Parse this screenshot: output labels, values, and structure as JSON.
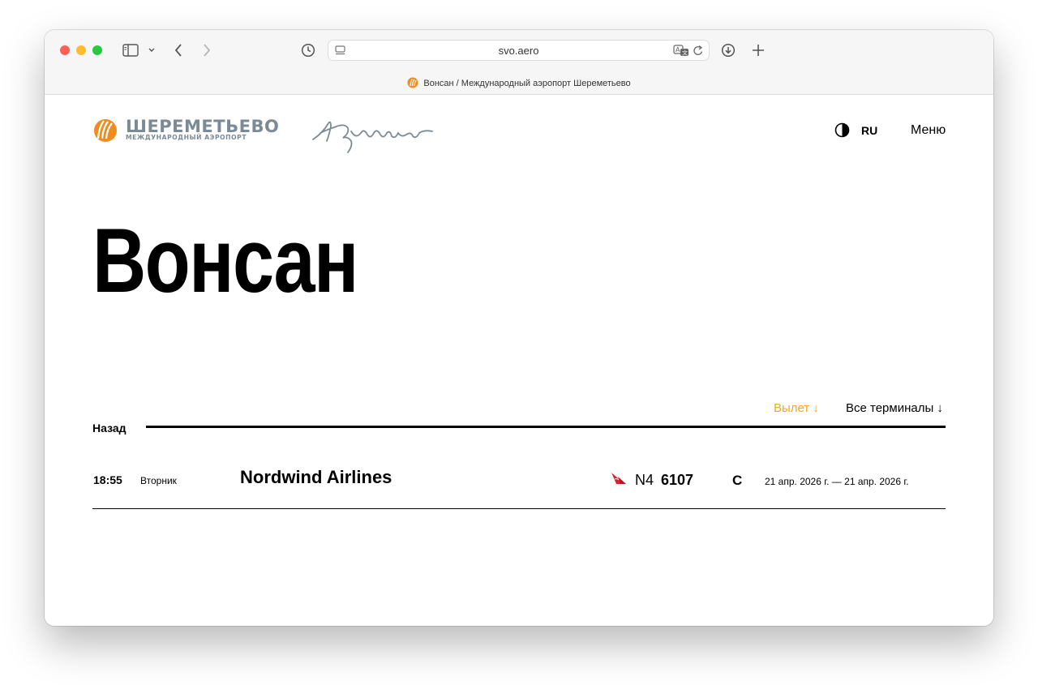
{
  "browser": {
    "url": "svo.aero",
    "tab_title": "Вонсан / Международный аэропорт Шереметьево"
  },
  "header": {
    "logo_main": "ШЕРЕМЕТЬЕВО",
    "logo_sub": "МЕЖДУНАРОДНЫЙ АЭРОПОРТ",
    "signature": "Пушкин",
    "language": "RU",
    "menu_label": "Меню"
  },
  "page": {
    "city_title": "Вонсан"
  },
  "filters": {
    "direction": "Вылет ↓",
    "terminals": "Все терминалы ↓"
  },
  "nav": {
    "back_label": "Назад"
  },
  "flights": [
    {
      "time": "18:55",
      "day": "Вторник",
      "airline": "Nordwind Airlines",
      "code": "N4",
      "number": "6107",
      "terminal": "C",
      "dates": "21 апр. 2026 г. — 21 апр. 2026 г."
    }
  ],
  "colors": {
    "accent": "#f5a623",
    "logo_orange": "#f08c1e",
    "logo_gray": "#7b8b96",
    "nordwind_red": "#d6242e"
  },
  "icons": [
    "sidebar-icon",
    "chevron-down-icon",
    "back-icon",
    "forward-icon",
    "history-icon",
    "page-icon",
    "translate-icon",
    "reload-icon",
    "download-icon",
    "plus-icon",
    "contrast-icon"
  ]
}
